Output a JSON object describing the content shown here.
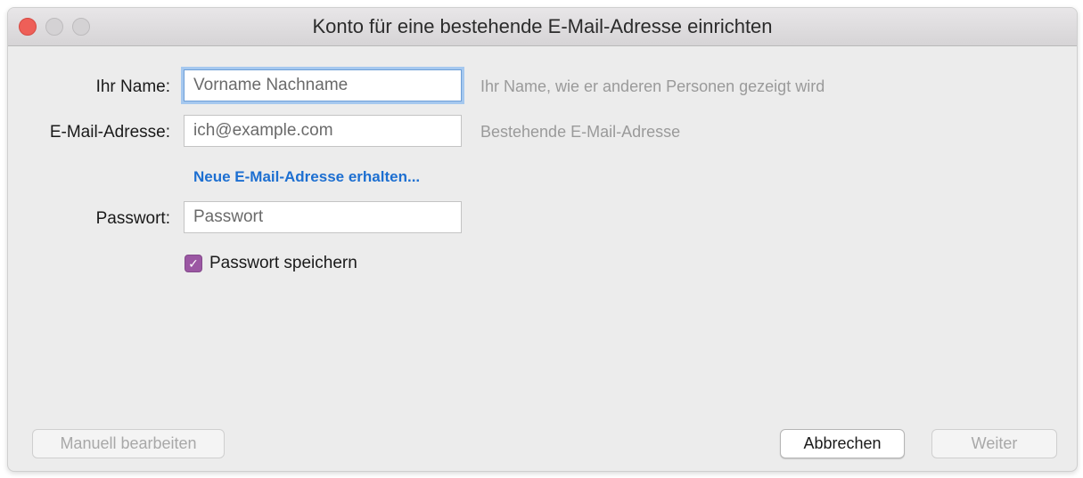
{
  "window": {
    "title": "Konto für eine bestehende E-Mail-Adresse einrichten"
  },
  "form": {
    "name_label": "Ihr Name:",
    "name_placeholder": "Vorname Nachname",
    "name_hint": "Ihr Name, wie er anderen Personen gezeigt wird",
    "email_label": "E-Mail-Adresse:",
    "email_placeholder": "ich@example.com",
    "email_hint": "Bestehende E-Mail-Adresse",
    "new_email_link": "Neue E-Mail-Adresse erhalten...",
    "password_label": "Passwort:",
    "password_placeholder": "Passwort",
    "save_password_label": "Passwort speichern",
    "save_password_checked": true
  },
  "buttons": {
    "manual_edit": "Manuell bearbeiten",
    "cancel": "Abbrechen",
    "next": "Weiter"
  },
  "colors": {
    "accent_link": "#1d6fd1",
    "checkbox": "#9b57a3",
    "close": "#ee5f58"
  }
}
